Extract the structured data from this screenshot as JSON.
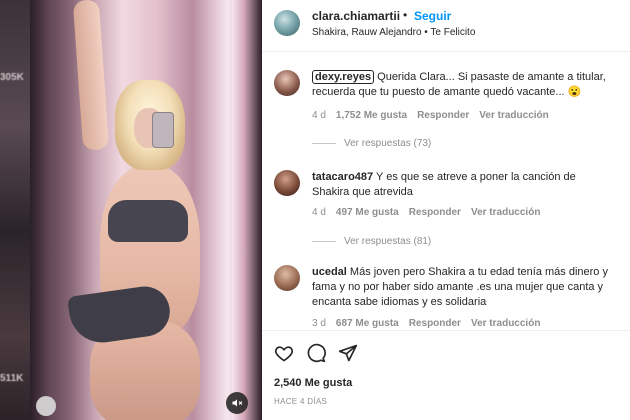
{
  "background": {
    "counts": [
      "305K",
      "511K"
    ]
  },
  "post": {
    "username": "clara.chiamartii",
    "follow_label": "Seguir",
    "separator": "•",
    "audio": "Shakira, Rauw Alejandro • Te Felicito"
  },
  "comments": [
    {
      "username": "dexy.reyes",
      "text": "Querida Clara... Si pasaste de amante a titular, recuerda que tu puesto de amante quedó vacante...",
      "emoji": "😮",
      "time": "4 d",
      "likes": "1,752 Me gusta",
      "reply_label": "Responder",
      "translate_label": "Ver traducción",
      "replies": "Ver respuestas (73)"
    },
    {
      "username": "tatacaro487",
      "text": "Y es que se atreve a poner la canción de Shakira que atrevida",
      "time": "4 d",
      "likes": "497 Me gusta",
      "reply_label": "Responder",
      "translate_label": "Ver traducción",
      "replies": "Ver respuestas (81)"
    },
    {
      "username": "ucedal",
      "text": "Más joven pero Shakira a tu edad tenía más dinero y fama y no por haber sido amante .es una mujer que canta y encanta sabe idiomas y es solidaria",
      "time": "3 d",
      "likes": "687 Me gusta",
      "reply_label": "Responder",
      "translate_label": "Ver traducción"
    }
  ],
  "actions": {
    "likes": "2,540 Me gusta",
    "time_ago": "HACE 4 DÍAS"
  },
  "colors": {
    "link": "#0095f6",
    "text": "#262626",
    "muted": "#8e8e8e"
  },
  "icons": [
    "heart-icon",
    "comment-icon",
    "share-icon",
    "mute-icon"
  ]
}
